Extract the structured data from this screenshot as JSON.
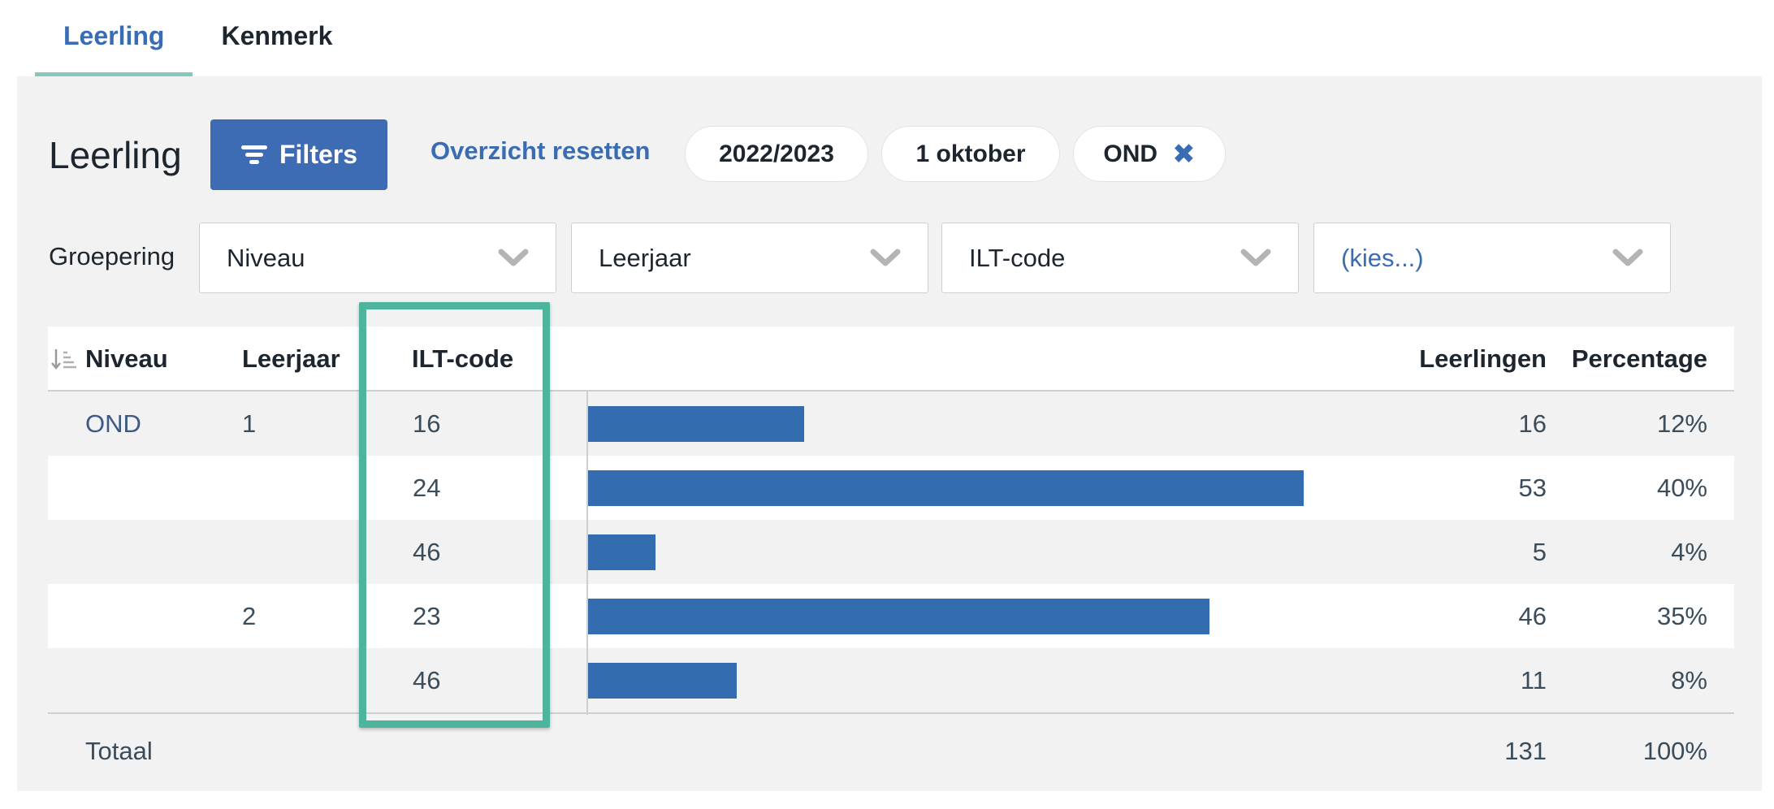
{
  "tabs": [
    {
      "label": "Leerling",
      "active": true
    },
    {
      "label": "Kenmerk",
      "active": false
    }
  ],
  "header": {
    "title": "Leerling",
    "filters_label": "Filters",
    "reset_label": "Overzicht resetten"
  },
  "chips": {
    "year": "2022/2023",
    "date": "1 oktober",
    "ond": "OND",
    "remove_symbol": "✖"
  },
  "grouping": {
    "label": "Groepering",
    "selects": [
      "Niveau",
      "Leerjaar",
      "ILT-code",
      "(kies...)"
    ]
  },
  "table": {
    "headers": {
      "niveau": "Niveau",
      "leerjaar": "Leerjaar",
      "ilt": "ILT-code",
      "leerlingen": "Leerlingen",
      "percentage": "Percentage"
    },
    "rows": [
      {
        "niveau": "OND",
        "leerjaar": "1",
        "ilt": "16",
        "leerlingen": "16",
        "percentage": "12%"
      },
      {
        "niveau": "",
        "leerjaar": "",
        "ilt": "24",
        "leerlingen": "53",
        "percentage": "40%"
      },
      {
        "niveau": "",
        "leerjaar": "",
        "ilt": "46",
        "leerlingen": "5",
        "percentage": "4%"
      },
      {
        "niveau": "",
        "leerjaar": "2",
        "ilt": "23",
        "leerlingen": "46",
        "percentage": "35%"
      },
      {
        "niveau": "",
        "leerjaar": "",
        "ilt": "46",
        "leerlingen": "11",
        "percentage": "8%"
      }
    ],
    "total": {
      "label": "Totaal",
      "leerlingen": "131",
      "percentage": "100%"
    }
  },
  "bar_values": [
    16,
    53,
    5,
    46,
    11
  ],
  "colors": {
    "accent": "#3d6cb4",
    "bar": "#336db0",
    "highlight": "#4eb59c",
    "tab_underline": "#86c7c2",
    "panel_bg": "#f2f2f2"
  }
}
